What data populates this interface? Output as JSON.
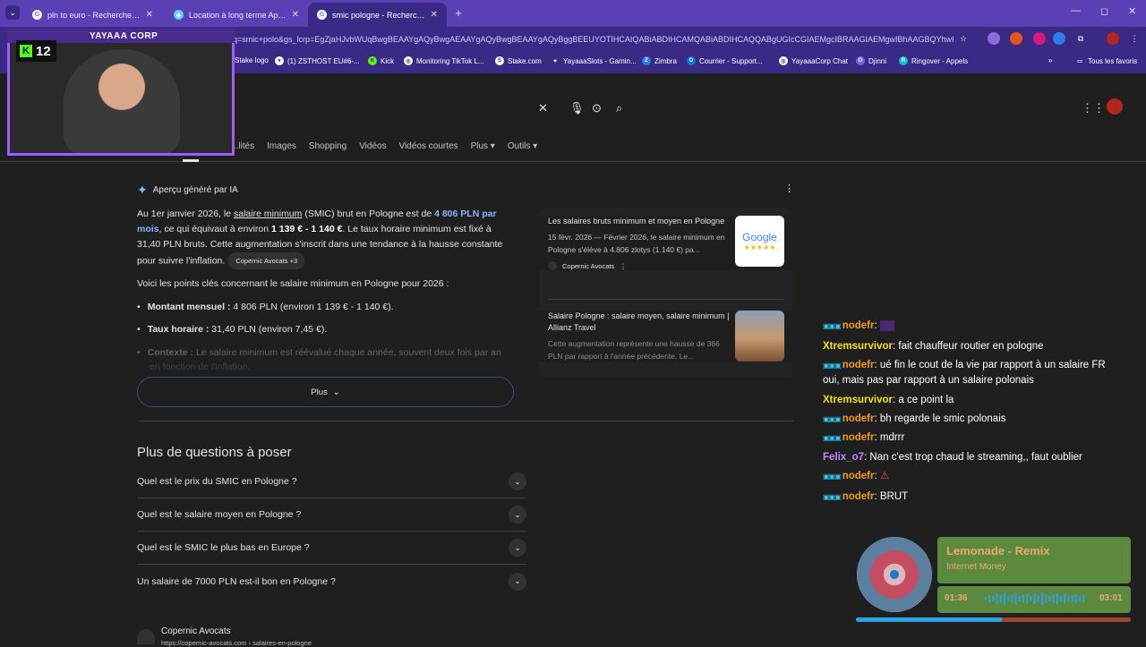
{
  "browser": {
    "tabs": [
      {
        "title": "pln to euro - Recherche Google",
        "active": false
      },
      {
        "title": "Location à long terme Appartem",
        "active": false
      },
      {
        "title": "smic pologne - Recherche Goo",
        "active": true
      }
    ],
    "new_tab": "+",
    "url": "oq=smic+polo&gs_lcrp=EgZjaHJvbWUqBwgBEAAYgAQyBwgAEAAYgAQyBwgBEAAYgAQyBggBEEUYOTIHCAIQABiABDIHCAMQABiABDIHCAQQABgUGIcCGIAEMgcIBRAAGIAEMgwIBhAAGBQYhwIYgAQyBwgHE...",
    "bookmarks": [
      {
        "label": "Stake logo"
      },
      {
        "label": "(1) ZSTHOST EU#6-..."
      },
      {
        "label": "Kick"
      },
      {
        "label": "Monitoring TikTok L..."
      },
      {
        "label": "Stake.com"
      },
      {
        "label": "YayaaaSlots - Gamin..."
      },
      {
        "label": "Zimbra"
      },
      {
        "label": "Courrier - Support..."
      },
      {
        "label": "YayaaaCorp Chat"
      },
      {
        "label": "Djinni"
      },
      {
        "label": "Ringover - Appels"
      }
    ],
    "bookmarks_more": "»",
    "all_favorites": "Tous les favoris"
  },
  "search": {
    "tabs": [
      "...lités",
      "Images",
      "Shopping",
      "Vidéos",
      "Vidéos courtes",
      "Plus ▾",
      "Outils ▾"
    ]
  },
  "ai_overview": {
    "header": "Aperçu généré par IA",
    "p1_pre": "Au 1er janvier 2026, le ",
    "p1_link": "salaire minimum",
    "p1_mid": " (SMIC) brut en Pologne est de ",
    "p1_amount": "4 806 PLN par mois",
    "p1_mid2": ", ce qui équivaut à environ ",
    "p1_eur": "1 139 € - 1 140 €",
    "p1_post": ". Le taux horaire minimum est fixé à 31,40 PLN bruts. Cette augmentation s'inscrit dans une tendance à la hausse constante pour suivre l'inflation.",
    "p1_chip": "Copernic Avocats +3",
    "p2": "Voici les points clés concernant le salaire minimum en Pologne pour 2026 :",
    "bullets": [
      {
        "label": "Montant mensuel :",
        "text": " 4 806 PLN (environ 1 139 € - 1 140 €)."
      },
      {
        "label": "Taux horaire :",
        "text": " 31,40 PLN (environ 7,45 €)."
      },
      {
        "label": "Contexte :",
        "text": " Le salaire minimum est réévalué chaque année, souvent deux fois par an"
      }
    ],
    "bullet3_cont": "en fonction de l'inflation.",
    "more_button": "Plus"
  },
  "sources": [
    {
      "title": "Les salaires bruts minimum et moyen en Pologne",
      "desc": "15 févr. 2026 — Février 2026, le salaire minimum en Pologne s'élève à 4.806 zlotys (1.140 €) pa...",
      "source": "Copernic Avocats"
    },
    {
      "title": "Salaire Pologne : salaire moyen, salaire minimum | Allianz Travel",
      "desc": "Cette augmentation représente une hausse de 366 PLN par rapport à l'année précédente. Le..."
    }
  ],
  "paa": {
    "title": "Plus de questions à poser",
    "questions": [
      "Quel est le prix du SMIC en Pologne ?",
      "Quel est le salaire moyen en Pologne ?",
      "Quel est le SMIC le plus bas en Europe ?",
      "Un salaire de 7000 PLN est-il bon en Pologne  ?"
    ]
  },
  "result": {
    "site": "Copernic Avocats",
    "url": "https://copernic-avocats.com › salaires-en-pologne"
  },
  "stream": {
    "cam_name": "YAYAAA CORP",
    "viewer_count": "12",
    "chat": [
      {
        "user": "nodefr",
        "color": "nodefr",
        "text": ""
      },
      {
        "user": "Xtremsurvivor",
        "color": "xtrem",
        "text": "fait chauffeur routier en pologne"
      },
      {
        "user": "nodefr",
        "color": "nodefr",
        "text": "ué fin le cout de la vie par rapport à un salaire FR oui, mais pas par rapport à un salaire polonais"
      },
      {
        "user": "Xtremsurvivor",
        "color": "xtrem",
        "text": "a ce point la"
      },
      {
        "user": "nodefr",
        "color": "nodefr",
        "text": "bh regarde le smic polonais"
      },
      {
        "user": "nodefr",
        "color": "nodefr",
        "text": "mdrrr"
      },
      {
        "user": "Felix_o7",
        "color": "felix",
        "text": "Nan c'est trop chaud le streaming,, faut oublier"
      },
      {
        "user": "nodefr",
        "color": "nodefr",
        "text": "⚠"
      },
      {
        "user": "nodefr",
        "color": "nodefr",
        "text": "BRUT"
      }
    ],
    "music": {
      "title": "Lemonade - Remix",
      "artist": "Internet Money",
      "current": "01:36",
      "total": "03:01",
      "progress_fraction": 0.53
    }
  }
}
